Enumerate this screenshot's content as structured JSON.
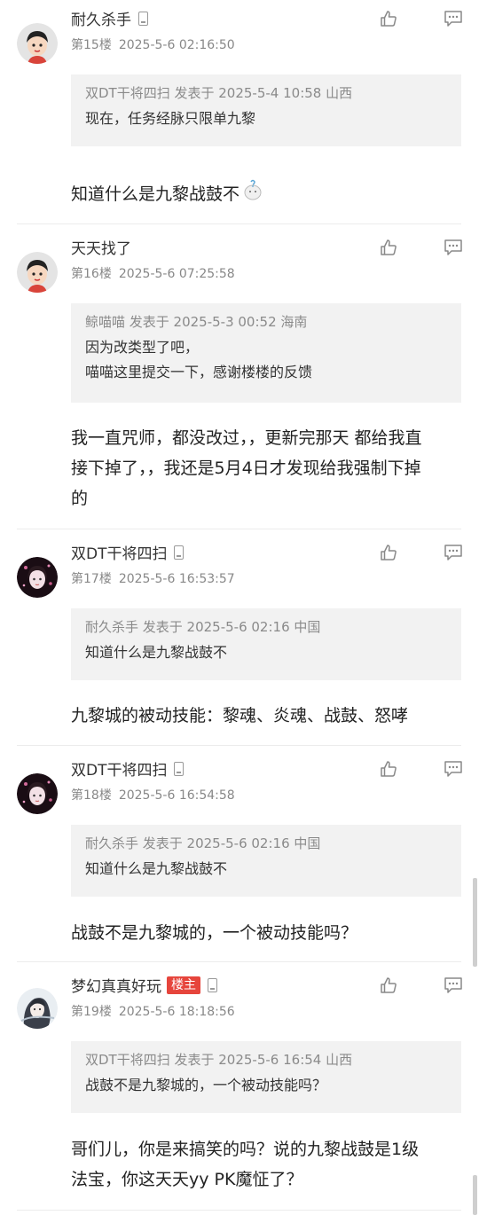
{
  "posts": [
    {
      "username": "耐久杀手",
      "has_device_icon": true,
      "floor": "第15楼",
      "time": "2025-5-6 02:16:50",
      "quote": {
        "header": "双DT干将四扫 发表于 2025-5-4 10:58 山西",
        "lines": [
          "现在，任务经脉只限单九黎"
        ]
      },
      "body": "知道什么是九黎战鼓不",
      "body_emoji": "confused-emoji"
    },
    {
      "username": "天天找了",
      "has_device_icon": false,
      "floor": "第16楼",
      "time": "2025-5-6 07:25:58",
      "quote": {
        "header": "鲸喵喵 发表于 2025-5-3 00:52 海南",
        "lines": [
          "因为改类型了吧，",
          "喵喵这里提交一下，感谢楼楼的反馈"
        ]
      },
      "body_lines": [
        "我一直咒师，都没改过，，更新完那天 都给我直",
        "接下掉了，，我还是5月4日才发现给我强制下掉",
        "的"
      ]
    },
    {
      "username": "双DT干将四扫",
      "has_device_icon": true,
      "floor": "第17楼",
      "time": "2025-5-6 16:53:57",
      "quote": {
        "header": "耐久杀手 发表于 2025-5-6 02:16 中国",
        "lines": [
          "知道什么是九黎战鼓不"
        ]
      },
      "body": "九黎城的被动技能：黎魂、炎魂、战鼓、怒哮"
    },
    {
      "username": "双DT干将四扫",
      "has_device_icon": true,
      "floor": "第18楼",
      "time": "2025-5-6 16:54:58",
      "quote": {
        "header": "耐久杀手 发表于 2025-5-6 02:16 中国",
        "lines": [
          "知道什么是九黎战鼓不"
        ]
      },
      "body": "战鼓不是九黎城的，一个被动技能吗？"
    },
    {
      "username": "梦幻真真好玩",
      "badge": "楼主",
      "has_device_icon": true,
      "floor": "第19楼",
      "time": "2025-5-6 18:18:56",
      "quote": {
        "header": "双DT干将四扫 发表于 2025-5-6 16:54 山西",
        "lines": [
          "战鼓不是九黎城的，一个被动技能吗？"
        ]
      },
      "body_lines": [
        "哥们儿，你是来搞笑的吗？说的九黎战鼓是1级",
        "法宝，你这天天yy PK魔怔了？"
      ]
    }
  ],
  "icons": {
    "like": "thumbs-up-icon",
    "comment": "comment-icon",
    "device": "phone-icon"
  },
  "colors": {
    "badge": "#e6453c",
    "quote_bg": "#f2f2f2",
    "meta": "#888888"
  }
}
